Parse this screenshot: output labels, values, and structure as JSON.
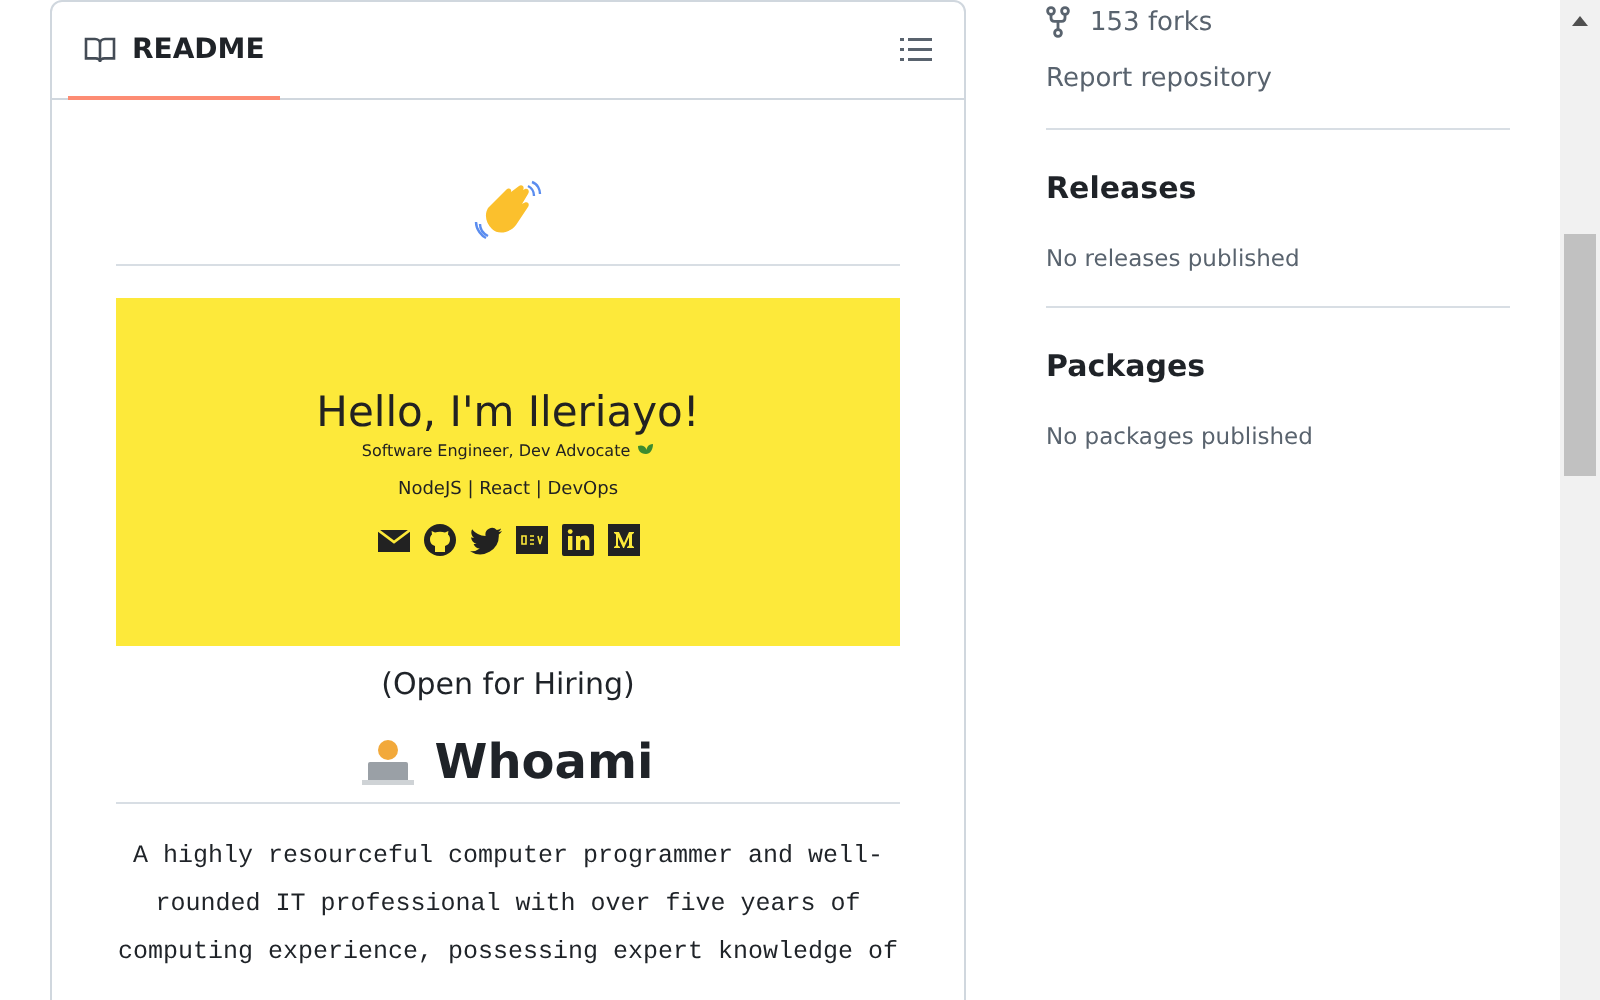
{
  "readme": {
    "tab": {
      "label": "README",
      "selected": true
    },
    "banner": {
      "title": "Hello, I'm Ileriayo!",
      "subtitle": "Software Engineer, Dev Advocate",
      "skills": "NodeJS | React | DevOps"
    },
    "hiring": "(Open for Hiring)",
    "heading": "Whoami",
    "paragraph": "A highly resourceful computer programmer and well-rounded IT professional with over five years of computing experience, possessing expert knowledge of"
  },
  "sidebar": {
    "forks": "153 forks",
    "report": "Report repository",
    "sections": [
      {
        "title": "Releases",
        "note": "No releases published"
      },
      {
        "title": "Packages",
        "note": "No packages published"
      }
    ]
  }
}
